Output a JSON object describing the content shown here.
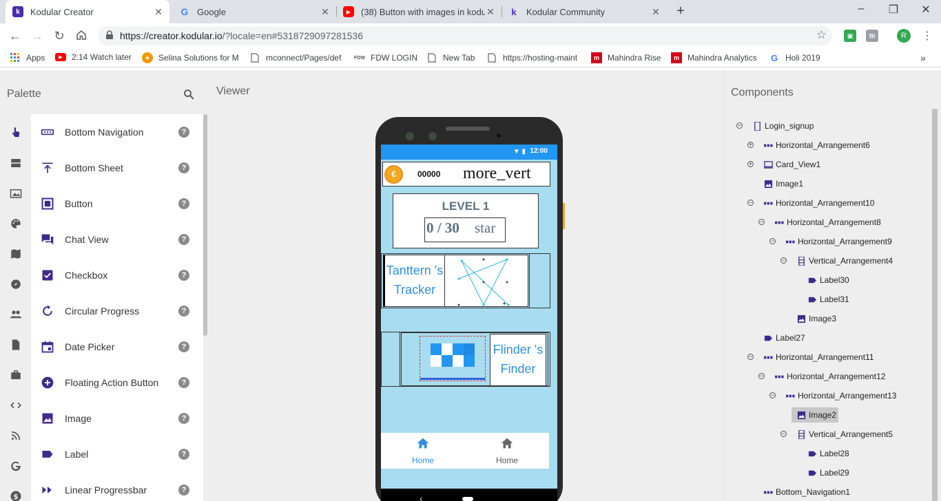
{
  "browser": {
    "tabs": [
      {
        "title": "Kodular Creator",
        "active": true
      },
      {
        "title": "Google",
        "active": false
      },
      {
        "title": "(38) Button with images in kodul...",
        "active": false
      },
      {
        "title": "Kodular Community",
        "active": false
      }
    ],
    "url_main": "https://creator.kodular.io",
    "url_rest": "/?locale=en#5318729097281536",
    "bookmarks": [
      {
        "label": "Apps"
      },
      {
        "label": "2:14 Watch later"
      },
      {
        "label": "Selina Solutions for M"
      },
      {
        "label": "mconnect/Pages/def"
      },
      {
        "label": "FDW LOGIN"
      },
      {
        "label": "New Tab"
      },
      {
        "label": "https://hosting-maint"
      },
      {
        "label": "Mahindra Rise"
      },
      {
        "label": "Mahindra Analytics"
      },
      {
        "label": "Holi 2019"
      }
    ],
    "profile_initial": "R"
  },
  "palette": {
    "title": "Palette",
    "items": [
      {
        "label": "Bottom Navigation"
      },
      {
        "label": "Bottom Sheet"
      },
      {
        "label": "Button"
      },
      {
        "label": "Chat View"
      },
      {
        "label": "Checkbox"
      },
      {
        "label": "Circular Progress"
      },
      {
        "label": "Date Picker"
      },
      {
        "label": "Floating Action Button"
      },
      {
        "label": "Image"
      },
      {
        "label": "Label"
      },
      {
        "label": "Linear Progressbar"
      }
    ],
    "help_symbol": "?"
  },
  "viewer": {
    "title": "Viewer",
    "status_time": "12:00",
    "coins": "00000",
    "coin_symbol": "€",
    "menu_text": "more_vert",
    "level_title": "LEVEL 1",
    "star_score": "0  / 30",
    "star_word": "star",
    "card1_label": "Tanttern 's Tracker",
    "card2_label": "Flinder 's Finder",
    "nav_items": [
      {
        "label": "Home",
        "active": true
      },
      {
        "label": "Home",
        "active": false
      }
    ],
    "sys_back": "‹"
  },
  "components": {
    "title": "Components",
    "tree": [
      {
        "label": "Login_signup"
      },
      {
        "label": "Horizontal_Arrangement6"
      },
      {
        "label": "Card_View1"
      },
      {
        "label": "Image1"
      },
      {
        "label": "Horizontal_Arrangement10"
      },
      {
        "label": "Horizontal_Arrangement8"
      },
      {
        "label": "Horizontal_Arrangement9"
      },
      {
        "label": "Vertical_Arrangement4"
      },
      {
        "label": "Label30"
      },
      {
        "label": "Label31"
      },
      {
        "label": "Image3"
      },
      {
        "label": "Label27"
      },
      {
        "label": "Horizontal_Arrangement11"
      },
      {
        "label": "Horizontal_Arrangement12"
      },
      {
        "label": "Horizontal_Arrangement13"
      },
      {
        "label": "Image2"
      },
      {
        "label": "Vertical_Arrangement5"
      },
      {
        "label": "Label28"
      },
      {
        "label": "Label29"
      },
      {
        "label": "Bottom_Navigation1"
      }
    ]
  },
  "colors": {
    "accent": "#3f2a8c",
    "statusbar": "#2196f3",
    "screen_bg": "#a8dcf0",
    "label_text": "#2f8fe0"
  }
}
